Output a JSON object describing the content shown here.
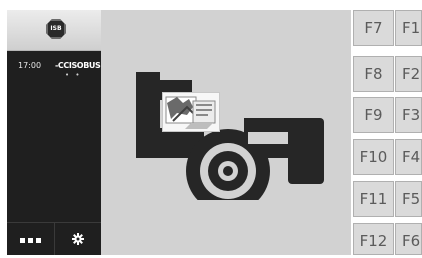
{
  "status_panel": {
    "badge_label": "ISB",
    "time": "17:00",
    "bus_label": "-CCISOBUS",
    "status_dots": "• •"
  },
  "bottom_bar": {
    "menu_icon": "three-dots-icon",
    "settings_icon": "gear-icon"
  },
  "softkeys": {
    "column1": [
      "F7",
      "F8",
      "F9",
      "F10",
      "F11",
      "F12"
    ],
    "column2": [
      "F1",
      "F2",
      "F3",
      "F4",
      "F5",
      "F6"
    ]
  },
  "colors": {
    "panel_dark": "#1f1f1f",
    "mask_background": "#d2d2d2",
    "softkey_background": "#dadada",
    "graphic_dark": "#262626"
  }
}
